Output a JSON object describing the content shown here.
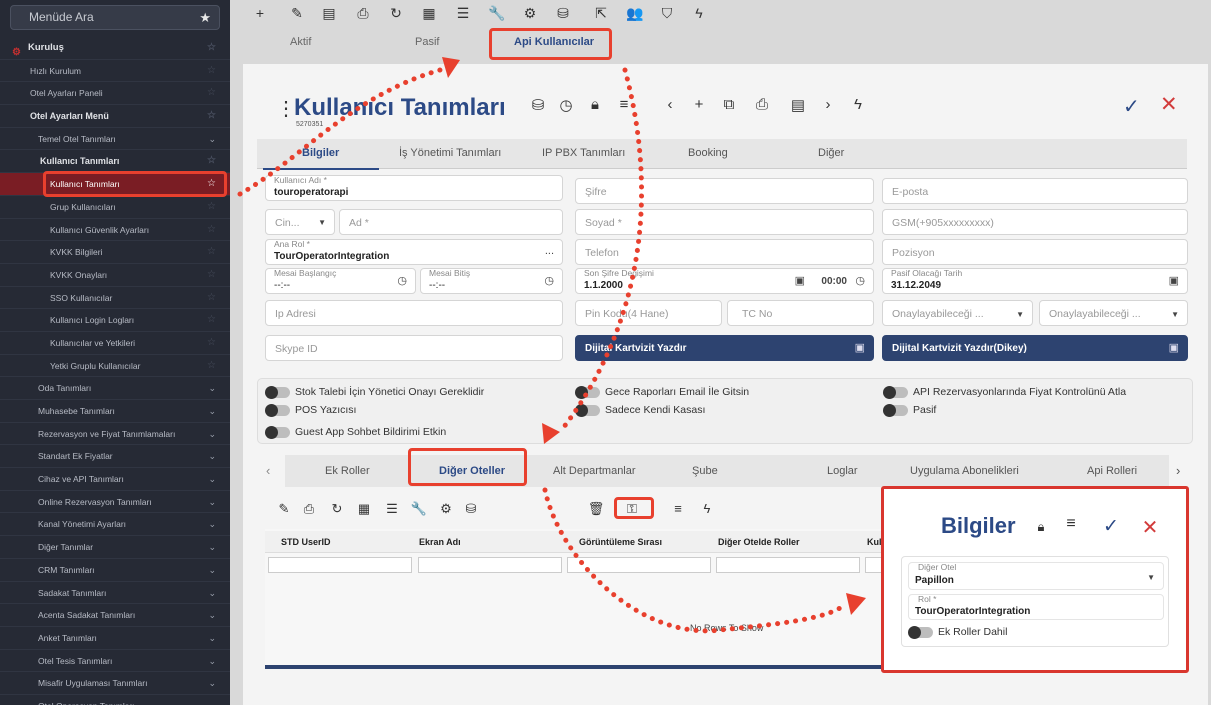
{
  "sidebar": {
    "search_placeholder": "Menüde Ara",
    "items": [
      {
        "label": "Kuruluş",
        "level": "lv0"
      },
      {
        "label": "Hızlı Kurulum",
        "level": "lv1"
      },
      {
        "label": "Otel Ayarları Paneli",
        "level": "lv1"
      },
      {
        "label": "Otel Ayarları Menü",
        "level": "lv1b"
      },
      {
        "label": "Temel Otel Tanımları",
        "level": "lv2",
        "chev": true
      },
      {
        "label": "Kullanıcı Tanımları",
        "level": "lv2b"
      },
      {
        "label": "Kullanıcı Tanımları",
        "level": "lv3",
        "active": true
      },
      {
        "label": "Grup Kullanıcıları",
        "level": "lv3"
      },
      {
        "label": "Kullanıcı Güvenlik Ayarları",
        "level": "lv3"
      },
      {
        "label": "KVKK Bilgileri",
        "level": "lv3"
      },
      {
        "label": "KVKK Onayları",
        "level": "lv3"
      },
      {
        "label": "SSO Kullanıcılar",
        "level": "lv3"
      },
      {
        "label": "Kullanıcı Login Logları",
        "level": "lv3"
      },
      {
        "label": "Kullanıcılar ve Yetkileri",
        "level": "lv3"
      },
      {
        "label": "Yetki Gruplu Kullanıcılar",
        "level": "lv3"
      },
      {
        "label": "Oda Tanımları",
        "level": "lv2",
        "chev": true
      },
      {
        "label": "Muhasebe Tanımları",
        "level": "lv2",
        "chev": true
      },
      {
        "label": "Rezervasyon ve Fiyat Tanımlamaları",
        "level": "lv2",
        "chev": true
      },
      {
        "label": "Standart Ek Fiyatlar",
        "level": "lv2",
        "chev": true
      },
      {
        "label": "Cihaz ve API Tanımları",
        "level": "lv2",
        "chev": true
      },
      {
        "label": "Online Rezervasyon Tanımları",
        "level": "lv2",
        "chev": true
      },
      {
        "label": "Kanal Yönetimi Ayarları",
        "level": "lv2",
        "chev": true
      },
      {
        "label": "Diğer Tanımlar",
        "level": "lv2",
        "chev": true
      },
      {
        "label": "CRM Tanımları",
        "level": "lv2",
        "chev": true
      },
      {
        "label": "Sadakat Tanımları",
        "level": "lv2",
        "chev": true
      },
      {
        "label": "Acenta Sadakat Tanımları",
        "level": "lv2",
        "chev": true
      },
      {
        "label": "Anket Tanımları",
        "level": "lv2",
        "chev": true
      },
      {
        "label": "Otel Tesis Tanımları",
        "level": "lv2",
        "chev": true
      },
      {
        "label": "Misafir Uygulaması Tanımları",
        "level": "lv2",
        "chev": true
      },
      {
        "label": "Otel Operasyon Tanımları",
        "level": "lv2",
        "chev": true
      }
    ]
  },
  "top_tabs": [
    "Aktif",
    "Pasif",
    "Api Kullanıcılar"
  ],
  "card": {
    "title": "Kullanıcı Tanımları",
    "code": "5270351"
  },
  "tabs": [
    "Bilgiler",
    "İş Yönetimi Tanımları",
    "IP PBX Tanımları",
    "Booking",
    "Diğer"
  ],
  "fields": {
    "username_label": "Kullanıcı Adı *",
    "username_value": "touroperatorapi",
    "password_ph": "Şifre",
    "email_ph": "E-posta",
    "gender_ph": "Cin...",
    "name_ph": "Ad *",
    "surname_ph": "Soyad *",
    "gsm_ph": "GSM(+905xxxxxxxxx)",
    "role_label": "Ana Rol *",
    "role_value": "TourOperatorIntegration",
    "role_dots": "...",
    "phone_ph": "Telefon",
    "position_ph": "Pozisyon",
    "shift_start_label": "Mesai Başlangıç",
    "shift_start_value": "--:--",
    "shift_end_label": "Mesai Bitiş",
    "shift_end_value": "--:--",
    "last_pw_label": "Son Şifre Değişimi",
    "last_pw_value": "1.1.2000",
    "last_pw_time": "00:00",
    "passive_label": "Pasif Olacağı Tarih",
    "passive_value": "31.12.2049",
    "ip_ph": "Ip Adresi",
    "pin_ph": "Pin Kodu(4 Hane)",
    "tc_ph": "TC No",
    "approve1_ph": "Onaylayabileceği ...",
    "approve2_ph": "Onaylayabileceği ...",
    "skype_ph": "Skype ID",
    "card_btn": "Dijital Kartvizit Yazdır",
    "card_btn_v": "Dijital Kartvizit Yazdır(Dikey)"
  },
  "toggles": [
    "Stok Talebi İçin Yönetici Onayı Gereklidir",
    "POS Yazıcısı",
    "Guest App Sohbet Bildirimi Etkin",
    "Gece Raporları Email İle Gitsin",
    "Sadece Kendi Kasası",
    "API Rezervasyonlarında Fiyat Kontrolünü Atla",
    "Pasif"
  ],
  "sub_tabs": [
    "Ek Roller",
    "Diğer Oteller",
    "Alt Departmanlar",
    "Şube",
    "Loglar",
    "Uygulama Abonelikleri",
    "Api Rolleri"
  ],
  "grid": {
    "columns": [
      "STD UserID",
      "Ekran Adı",
      "Görüntüleme Sırası",
      "Diğer Otelde Roller",
      "Kul"
    ],
    "empty": "No Rows To Show"
  },
  "popup": {
    "title": "Bilgiler",
    "other_hotel_label": "Diğer Otel",
    "other_hotel_value": "Papillon",
    "role_label": "Rol *",
    "role_value": "TourOperatorIntegration",
    "toggle_label": "Ek Roller Dahil"
  },
  "colors": {
    "brand": "#2c4a86",
    "danger": "#d23b3b",
    "sidebar": "#262a35",
    "highlight": "#e8402e"
  }
}
